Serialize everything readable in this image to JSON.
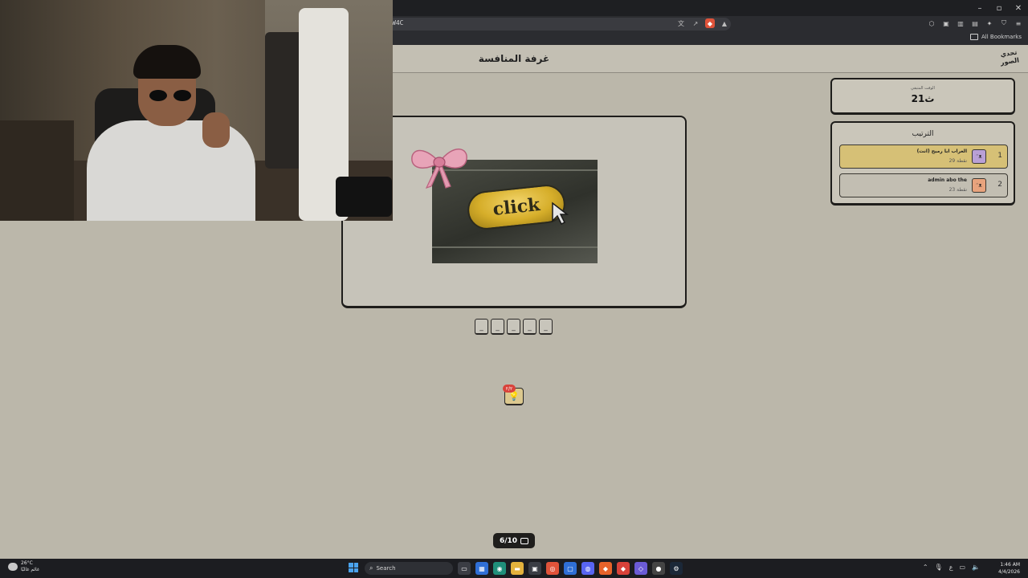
{
  "browser": {
    "url_fragment": "W4C",
    "bookmarks_label": "All Bookmarks",
    "window_controls": [
      "–",
      "▫",
      "✕"
    ]
  },
  "header": {
    "title": "غرفة المنافسة",
    "logo": "تحدي الصور"
  },
  "timer": {
    "label": "الوقت المتبقي",
    "value": "21ث"
  },
  "ranking": {
    "title": "الترتيب",
    "players": [
      {
        "rank": "1",
        "name": "الغراب ابا رميح (انت)",
        "points": "29 نقطة"
      },
      {
        "rank": "2",
        "name": "admin abo the",
        "points": "23 نقطة"
      }
    ]
  },
  "puzzle": {
    "image_word": "click",
    "slots": [
      "_",
      "_",
      "_",
      "_",
      "_"
    ]
  },
  "hint": {
    "badge": "٢/٢",
    "icon": "lightbulb-icon"
  },
  "progress": {
    "text": "6/10",
    "current": 6,
    "total": 10
  },
  "taskbar": {
    "weather_temp": "26°C",
    "weather_desc": "غائم غالبًا",
    "search_label": "Search",
    "time": "1:46 AM",
    "date": "4/4/2026",
    "lang": "ع"
  },
  "colors": {
    "page_bg": "#bbb7aa",
    "card_bg": "#cac6ba",
    "first_place": "#d6c076",
    "accent_red": "#d9423a"
  }
}
